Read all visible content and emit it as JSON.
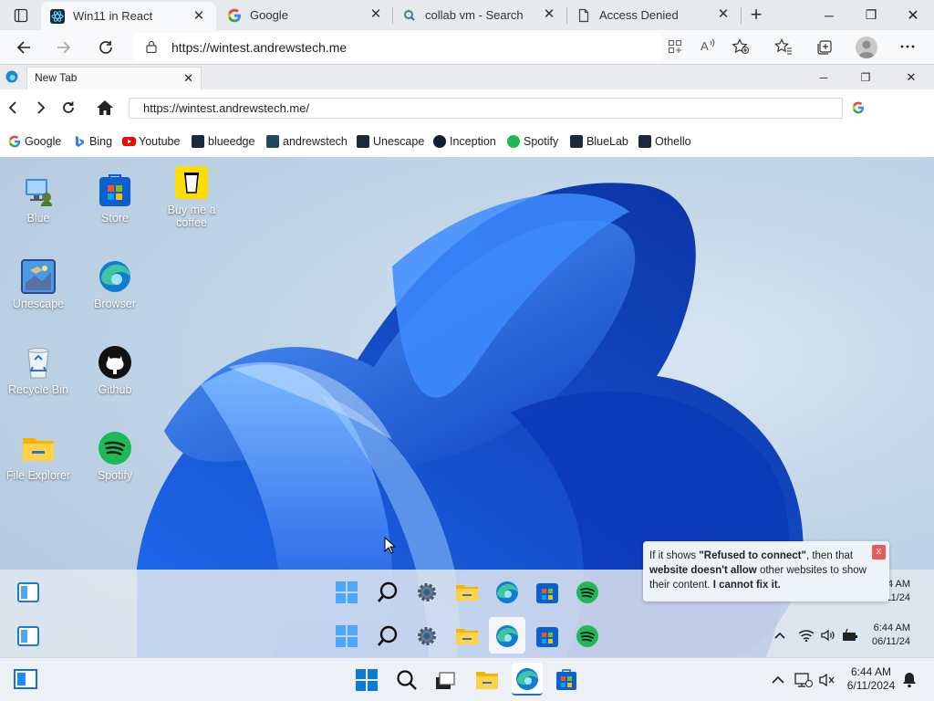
{
  "outer_browser": {
    "tabs": [
      {
        "label": "Win11 in React"
      },
      {
        "label": "Google"
      },
      {
        "label": "collab vm - Search"
      },
      {
        "label": "Access Denied"
      }
    ],
    "url": "https://wintest.andrewstech.me",
    "newtab_symbol": "+",
    "close_symbol": "✕",
    "min_symbol": "─",
    "restore_symbol": "❐"
  },
  "inner_browser": {
    "tab_label": "New Tab",
    "url": "https://wintest.andrewstech.me/",
    "bookmarks": [
      {
        "label": "Google",
        "color": "#4285f4"
      },
      {
        "label": "Bing",
        "color": "#2f7ef5"
      },
      {
        "label": "Youtube",
        "color": "#ff0000"
      },
      {
        "label": "blueedge",
        "color": "#1a2a3a"
      },
      {
        "label": "andrewstech",
        "color": "#1e4a5a"
      },
      {
        "label": "Unescape",
        "color": "#1a2a3a"
      },
      {
        "label": "Inception",
        "color": "#102030"
      },
      {
        "label": "Spotify",
        "color": "#1db954"
      },
      {
        "label": "BlueLab",
        "color": "#1a2a3a"
      },
      {
        "label": "Othello",
        "color": "#1a2a3a"
      }
    ]
  },
  "desktop": {
    "icons": [
      {
        "label": "Blue"
      },
      {
        "label": "Store"
      },
      {
        "label": "Buy me a coffee"
      },
      {
        "label": "Unescape"
      },
      {
        "label": "Browser"
      },
      {
        "label": "Recycle Bin"
      },
      {
        "label": "Github"
      },
      {
        "label": "File Explorer"
      },
      {
        "label": "Spotify"
      }
    ],
    "notice": {
      "part1": "If it shows ",
      "bold1": "\"Refused to connect\"",
      "part2": ", then that ",
      "bold2": "website doesn't allow",
      "part3": " other websites to show their content. ",
      "bold3": "I cannot fix it.",
      "close": "x"
    },
    "taskbar1": {
      "time": "6:44 AM",
      "date": "06/11/24"
    },
    "taskbar2": {
      "time": "6:44 AM",
      "date": "06/11/24"
    }
  },
  "host_taskbar": {
    "time": "6:44 AM",
    "date": "6/11/2024"
  }
}
